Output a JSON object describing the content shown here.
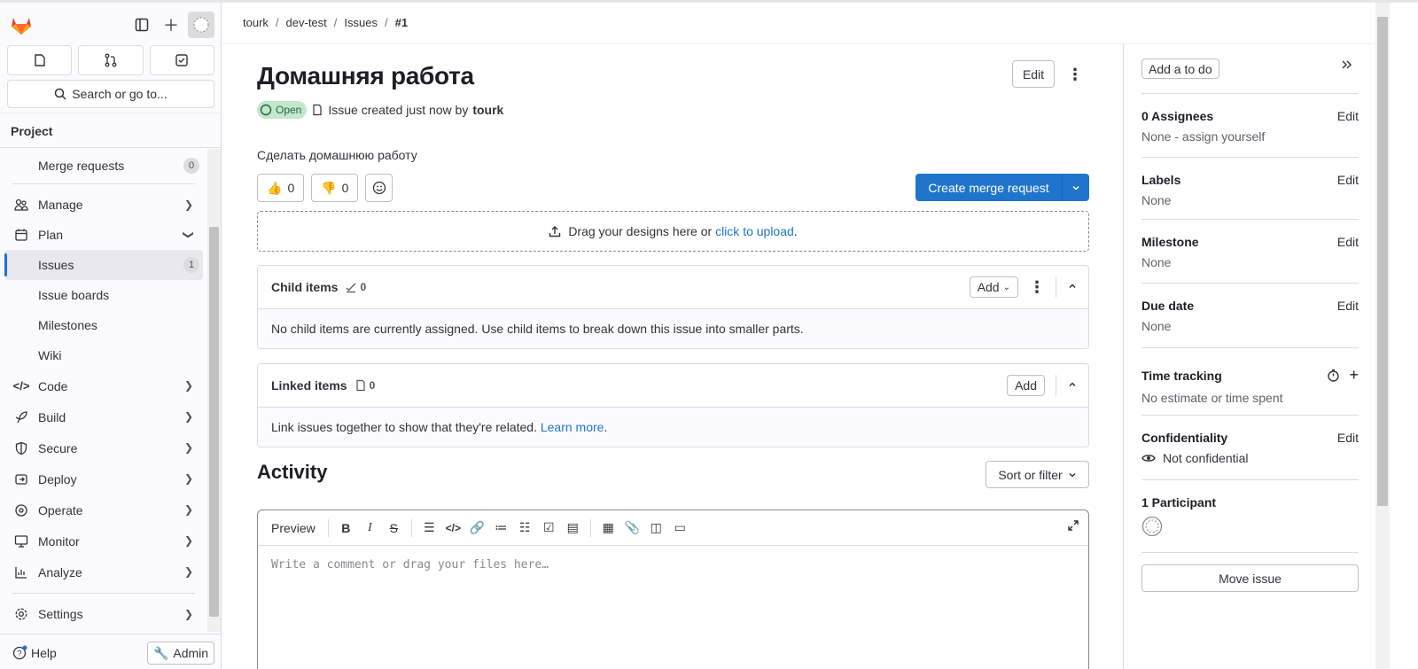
{
  "sidebar": {
    "search_label": "Search or go to...",
    "section_title": "Project",
    "items": [
      {
        "label": "Merge requests",
        "count": "0",
        "type": "sub"
      },
      {
        "label": "Manage",
        "type": "group"
      },
      {
        "label": "Plan",
        "type": "group-open"
      },
      {
        "label": "Issues",
        "count": "1",
        "type": "active"
      },
      {
        "label": "Issue boards",
        "type": "sub"
      },
      {
        "label": "Milestones",
        "type": "sub"
      },
      {
        "label": "Wiki",
        "type": "sub"
      },
      {
        "label": "Code",
        "type": "group"
      },
      {
        "label": "Build",
        "type": "group"
      },
      {
        "label": "Secure",
        "type": "group"
      },
      {
        "label": "Deploy",
        "type": "group"
      },
      {
        "label": "Operate",
        "type": "group"
      },
      {
        "label": "Monitor",
        "type": "group"
      },
      {
        "label": "Analyze",
        "type": "group"
      },
      {
        "label": "Settings",
        "type": "group"
      }
    ],
    "help_label": "Help",
    "admin_label": "Admin"
  },
  "breadcrumb": [
    "tourk",
    "dev-test",
    "Issues",
    "#1"
  ],
  "issue": {
    "title": "Домашняя работа",
    "edit_label": "Edit",
    "status": "Open",
    "created_text": "Issue created just now by",
    "author": "tourk",
    "description": "Сделать домашнюю работу",
    "thumbs_up": "0",
    "thumbs_down": "0",
    "create_mr_label": "Create merge request",
    "drop_text": "Drag your designs here or",
    "drop_link": "click to upload",
    "drop_end": "."
  },
  "child_items": {
    "title": "Child items",
    "count": "0",
    "add_label": "Add",
    "empty_text": "No child items are currently assigned. Use child items to break down this issue into smaller parts."
  },
  "linked_items": {
    "title": "Linked items",
    "count": "0",
    "add_label": "Add",
    "empty_text": "Link issues together to show that they're related.",
    "learn_more": "Learn more",
    "learn_end": "."
  },
  "activity": {
    "title": "Activity",
    "sort_label": "Sort or filter",
    "preview_label": "Preview",
    "placeholder": "Write a comment or drag your files here…"
  },
  "right_sidebar": {
    "todo_label": "Add a to do",
    "assignees": {
      "title": "0 Assignees",
      "edit": "Edit",
      "value": "None - assign yourself"
    },
    "labels": {
      "title": "Labels",
      "edit": "Edit",
      "value": "None"
    },
    "milestone": {
      "title": "Milestone",
      "edit": "Edit",
      "value": "None"
    },
    "due_date": {
      "title": "Due date",
      "edit": "Edit",
      "value": "None"
    },
    "time_tracking": {
      "title": "Time tracking",
      "value": "No estimate or time spent"
    },
    "confidentiality": {
      "title": "Confidentiality",
      "edit": "Edit",
      "value": "Not confidential"
    },
    "participants": {
      "title": "1 Participant"
    },
    "move_label": "Move issue"
  },
  "colors": {
    "accent": "#1f75cb",
    "open_badge_bg": "#c3e6cd",
    "open_badge_fg": "#24663b",
    "logo": "#e24329"
  }
}
